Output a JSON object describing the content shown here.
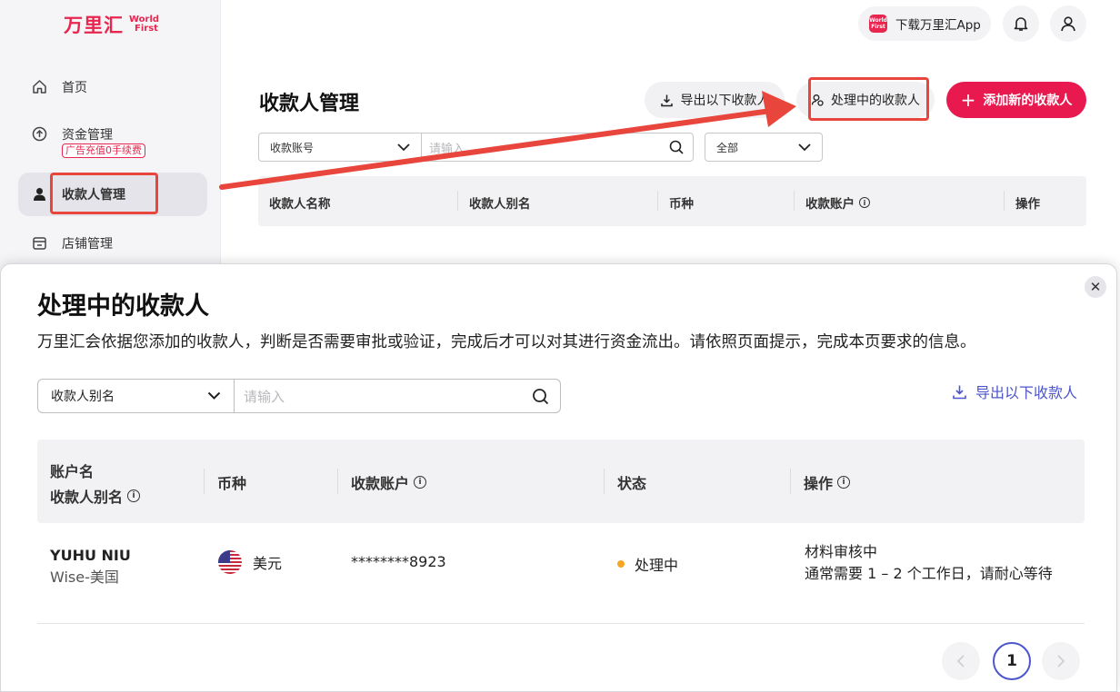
{
  "brand": {
    "name_cn": "万里汇",
    "name_en_line1": "World",
    "name_en_line2": "First",
    "accent": "#e8194f"
  },
  "sidebar": {
    "items": [
      {
        "label": "首页",
        "icon": "home-icon"
      },
      {
        "label": "资金管理",
        "icon": "arrow-up-circle-icon",
        "badge": "广告充值0手续费"
      },
      {
        "label": "收款人管理",
        "icon": "user-icon",
        "active": true
      },
      {
        "label": "店铺管理",
        "icon": "store-icon"
      }
    ]
  },
  "topbar": {
    "app_download": "下载万里汇App",
    "app_icon_text1": "World",
    "app_icon_text2": "First"
  },
  "page": {
    "title": "收款人管理",
    "export_label": "导出以下收款人",
    "processing_label": "处理中的收款人",
    "add_label": "添加新的收款人",
    "filter_type": "收款账号",
    "search_placeholder": "请输入",
    "status_filter": "全部",
    "columns": [
      "收款人名称",
      "收款人别名",
      "币种",
      "收款账户",
      "操作"
    ]
  },
  "modal": {
    "title": "处理中的收款人",
    "description": "万里汇会依据您添加的收款人，判断是否需要审批或验证，完成后才可以对其进行资金流出。请依照页面提示，完成本页要求的信息。",
    "filter_type": "收款人别名",
    "search_placeholder": "请输入",
    "export_label": "导出以下收款人",
    "columns": {
      "account_name": "账户名",
      "alias": "收款人别名",
      "currency": "币种",
      "account": "收款账户",
      "status": "状态",
      "action": "操作"
    },
    "rows": [
      {
        "account_name": "YUHU NIU",
        "alias": "Wise-美国",
        "currency": "美元",
        "currency_flag": "us-flag-icon",
        "account": "********8923",
        "status": "处理中",
        "status_color": "#f5a623",
        "action_line1": "材料审核中",
        "action_line2": "通常需要 1 – 2 个工作日，请耐心等待"
      }
    ],
    "pagination": {
      "current": "1"
    }
  }
}
